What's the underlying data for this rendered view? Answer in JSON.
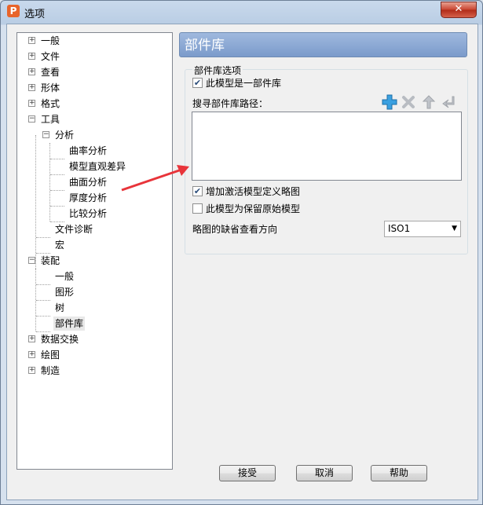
{
  "window": {
    "title": "选项",
    "close_glyph": "✕",
    "app_icon_letter": "P"
  },
  "tree": {
    "items": [
      {
        "label": "一般",
        "expander": "+"
      },
      {
        "label": "文件",
        "expander": "+"
      },
      {
        "label": "查看",
        "expander": "+"
      },
      {
        "label": "形体",
        "expander": "+"
      },
      {
        "label": "格式",
        "expander": "+"
      },
      {
        "label": "工具",
        "expander": "−"
      },
      {
        "label": "分析",
        "expander": "−"
      },
      {
        "label": "曲率分析"
      },
      {
        "label": "模型直观差异"
      },
      {
        "label": "曲面分析"
      },
      {
        "label": "厚度分析"
      },
      {
        "label": "比较分析"
      },
      {
        "label": "文件诊断"
      },
      {
        "label": "宏"
      },
      {
        "label": "装配",
        "expander": "−"
      },
      {
        "label": "一般"
      },
      {
        "label": "图形"
      },
      {
        "label": "树"
      },
      {
        "label": "部件库",
        "selected": true
      },
      {
        "label": "数据交换",
        "expander": "+"
      },
      {
        "label": "绘图",
        "expander": "+"
      },
      {
        "label": "制造",
        "expander": "+"
      }
    ]
  },
  "panel": {
    "header": "部件库",
    "group_title": "部件库选项",
    "is_library_label": "此模型是一部件库",
    "is_library_checked": true,
    "search_path_label": "搜寻部件库路径：",
    "toolbar_icons": [
      "add-icon",
      "delete-icon",
      "move-up-icon",
      "move-down-icon"
    ],
    "search_paths": [],
    "add_activate_label": "增加激活模型定义略图",
    "add_activate_checked": true,
    "preserve_original_label": "此模型为保留原始模型",
    "preserve_original_checked": false,
    "view_direction_label": "略图的缺省查看方向",
    "view_direction_value": "ISO1"
  },
  "buttons": {
    "ok": "接受",
    "cancel": "取消",
    "help": "帮助"
  },
  "colors": {
    "header_bg": "#7b9bcb",
    "annotation_arrow": "#e8343a",
    "add_icon": "#3aa0e0"
  }
}
